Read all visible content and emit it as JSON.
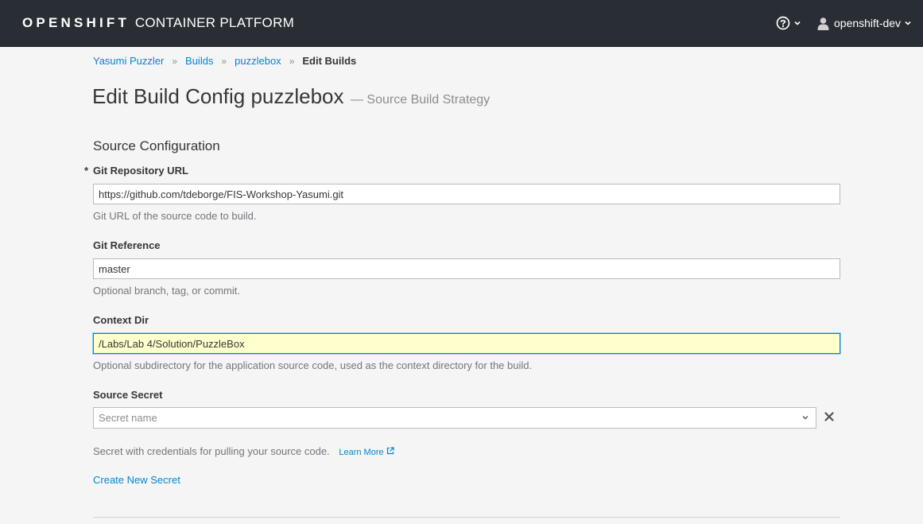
{
  "header": {
    "brand_bold": "OPENSHIFT",
    "brand_light": "CONTAINER PLATFORM",
    "username": "openshift-dev"
  },
  "breadcrumb": {
    "items": [
      "Yasumi Puzzler",
      "Builds",
      "puzzlebox"
    ],
    "current": "Edit Builds"
  },
  "page": {
    "title": "Edit Build Config puzzlebox",
    "subtitle": "— Source Build Strategy"
  },
  "form": {
    "section_title": "Source Configuration",
    "git_url": {
      "required_mark": "*",
      "label": "Git Repository URL",
      "value": "https://github.com/tdeborge/FIS-Workshop-Yasumi.git",
      "help": "Git URL of the source code to build."
    },
    "git_ref": {
      "label": "Git Reference",
      "value": "master",
      "help": "Optional branch, tag, or commit."
    },
    "context_dir": {
      "label": "Context Dir",
      "value": "/Labs/Lab 4/Solution/PuzzleBox",
      "help": "Optional subdirectory for the application source code, used as the context directory for the build."
    },
    "source_secret": {
      "label": "Source Secret",
      "placeholder": "Secret name",
      "help": "Secret with credentials for pulling your source code.",
      "learn_more": "Learn More",
      "create_link": "Create New Secret"
    }
  },
  "colors": {
    "topbar_bg": "#292e34",
    "link": "#0088ce",
    "focus_bg": "#ffffcd"
  }
}
